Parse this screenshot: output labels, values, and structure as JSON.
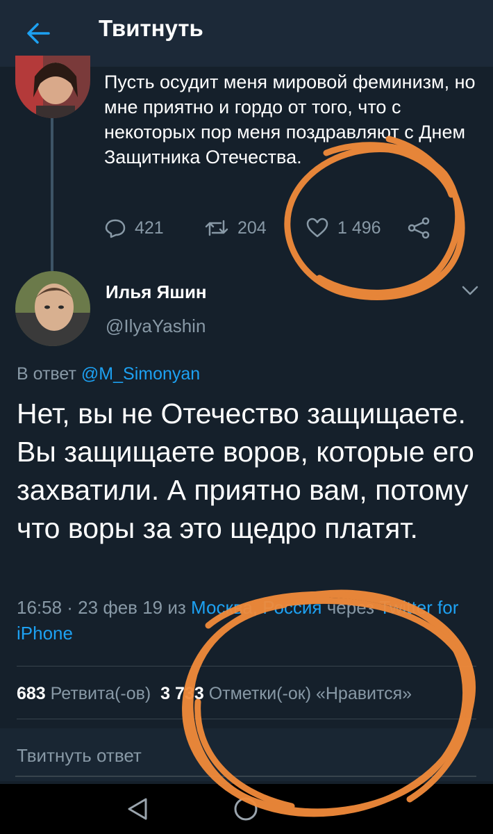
{
  "header": {
    "title": "Твитнуть",
    "back_icon": "arrow-left-icon"
  },
  "parent_tweet": {
    "text": "Пусть осудит меня мировой феминизм, но мне приятно и гордо от того, что с некоторых пор меня поздравляют с Днем Защитника Отечества.",
    "replies": "421",
    "retweets": "204",
    "likes": "1 496"
  },
  "main_tweet": {
    "author_name": "Илья Яшин",
    "author_handle": "@IlyaYashin",
    "reply_prefix": "В ответ",
    "reply_mention": "@M_Simonyan",
    "text": "Нет, вы не Отечество защищаете. Вы защищаете воров, которые его захватили. А приятно вам, потому что воры за это щедро платят.",
    "timestamp": "16:58 · 23 фев 19 из",
    "location": "Москва, Россия",
    "via": "через",
    "source": "Twitter for iPhone",
    "retweet_count": "683",
    "retweet_label": "Ретвита(-ов)",
    "like_count": "3 733",
    "like_label": "Отметки(-ок) «Нравится»"
  },
  "reply_box": {
    "placeholder": "Твитнуть ответ"
  },
  "colors": {
    "background": "#15202b",
    "header": "#1c2938",
    "accent": "#1da1f2",
    "secondary_text": "#8899a6",
    "annotation": "#f28b3a"
  }
}
